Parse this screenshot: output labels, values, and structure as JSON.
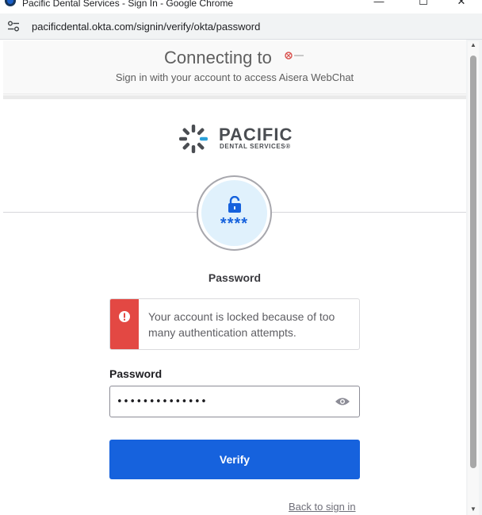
{
  "window": {
    "title": "Pacific Dental Services - Sign In - Google Chrome",
    "minimize_glyph": "—",
    "maximize_glyph": "☐",
    "close_glyph": "✕"
  },
  "browser": {
    "url": "pacificdental.okta.com/signin/verify/okta/password"
  },
  "header": {
    "connecting_text": "Connecting to",
    "app_logo_icon": "aisera-logo-icon",
    "subtitle": "Sign in with your account to access Aisera WebChat"
  },
  "brand": {
    "name": "PACIFIC",
    "sub": "DENTAL SERVICES®"
  },
  "factor": {
    "icon": "unlock-icon",
    "stars": "****",
    "title": "Password"
  },
  "alert": {
    "icon": "error-icon",
    "message": "Your account is locked because of too many authentication attempts."
  },
  "password_field": {
    "label": "Password",
    "value": "••••••••••••••",
    "toggle_icon": "eye-icon"
  },
  "verify_button": {
    "label": "Verify"
  },
  "back_link": {
    "label": "Back to sign in"
  },
  "colors": {
    "primary": "#1662dd",
    "error": "#e34843",
    "factor_bg": "#e0f1fc"
  }
}
